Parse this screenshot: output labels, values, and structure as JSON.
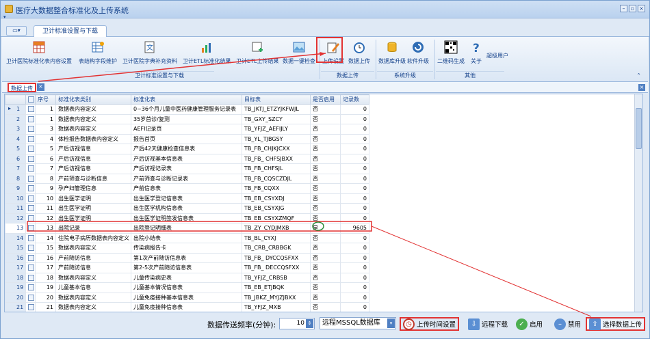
{
  "window": {
    "title": "医疗大数据整合标准化及上传系统"
  },
  "tabs": [
    {
      "label": "卫计标准设置与下载"
    }
  ],
  "ribbon": {
    "buttons": [
      {
        "label": "卫计医院标准化表内容设置",
        "icon": "grid-icon"
      },
      {
        "label": "表结构字段维护",
        "icon": "table-edit-icon"
      },
      {
        "label": "卫计医院字典补充资料",
        "icon": "dictionary-icon"
      },
      {
        "label": "卫计ETL标准化结果",
        "icon": "chart-icon"
      },
      {
        "label": "卫计ETL上传结果",
        "icon": "upload-result-icon"
      },
      {
        "label": "数据一键检查",
        "icon": "picture-check-icon"
      },
      {
        "label": "上传设置",
        "icon": "pencil-icon"
      },
      {
        "label": "数据上传",
        "icon": "clock-icon"
      },
      {
        "label": "数据库升级",
        "icon": "database-icon"
      },
      {
        "label": "软件升级",
        "icon": "refresh-icon"
      },
      {
        "label": "二维码生成",
        "icon": "qrcode-icon"
      },
      {
        "label": "关于",
        "icon": "question-icon"
      },
      {
        "label": "超级用户",
        "icon": ""
      }
    ],
    "groups": [
      "卫计标准设置与下载",
      "数据上传",
      "系统升级",
      "其他"
    ]
  },
  "panel": {
    "title": "数据上传"
  },
  "table": {
    "columns": [
      "序号",
      "标准化表类别",
      "标准化表",
      "目标表",
      "是否启用",
      "记录数"
    ],
    "rows": [
      {
        "rownum": "1",
        "no": "1",
        "category": "数据表内容定义",
        "table": "0~36个月儿童中医药健康管理服务记录表",
        "target": "TB_JKTJ_ETZYJKFWJL",
        "enabled": "否",
        "count": "0"
      },
      {
        "rownum": "2",
        "no": "1",
        "category": "数据表内容定义",
        "table": "35岁首诊/复测",
        "target": "TB_GXY_SZCY",
        "enabled": "否",
        "count": "0"
      },
      {
        "rownum": "3",
        "no": "3",
        "category": "数据表内容定义",
        "table": "AEFI记录页",
        "target": "TB_YFJZ_AEFIJLY",
        "enabled": "否",
        "count": "0"
      },
      {
        "rownum": "4",
        "no": "4",
        "category": "体检报告数据表内容定义",
        "table": "报告首页",
        "target": "TB_YL_TJBGSY",
        "enabled": "否",
        "count": "0"
      },
      {
        "rownum": "5",
        "no": "5",
        "category": "产后访视信息",
        "table": "产后42天健康检查信息表",
        "target": "TB_FB_CHJKJCXX",
        "enabled": "否",
        "count": "0"
      },
      {
        "rownum": "6",
        "no": "6",
        "category": "产后访视信息",
        "table": "产后访视基本信息表",
        "target": "TB_FB_ CHFSJBXX",
        "enabled": "否",
        "count": "0"
      },
      {
        "rownum": "7",
        "no": "7",
        "category": "产后访视信息",
        "table": "产后访视记录表",
        "target": "TB_FB_CHFSJL",
        "enabled": "否",
        "count": "0"
      },
      {
        "rownum": "8",
        "no": "8",
        "category": "产前筛查与诊断信息",
        "table": "产前筛查与诊断记录表",
        "target": "TB_FB_CQSCZDJL",
        "enabled": "否",
        "count": "0"
      },
      {
        "rownum": "9",
        "no": "9",
        "category": "孕产妇管理信息",
        "table": "产前信息表",
        "target": "TB_FB_CQXX",
        "enabled": "否",
        "count": "0"
      },
      {
        "rownum": "10",
        "no": "10",
        "category": "出生医学证明",
        "table": "出生医学登记信息表",
        "target": "TB_EB_CSYXDJ",
        "enabled": "否",
        "count": "0"
      },
      {
        "rownum": "11",
        "no": "11",
        "category": "出生医学证明",
        "table": "出生医学机构信息表",
        "target": "TB_EB_CSYXJG",
        "enabled": "否",
        "count": "0"
      },
      {
        "rownum": "12",
        "no": "12",
        "category": "出生医学证明",
        "table": "出生医学证明签发信息表",
        "target": "TB_EB_CSYXZMQF",
        "enabled": "否",
        "count": "0"
      },
      {
        "rownum": "13",
        "no": "13",
        "category": "出院记录",
        "table": "出院登记明细表",
        "target": "TB_ZY_CYDJMXB",
        "enabled": "是",
        "count": "9605"
      },
      {
        "rownum": "14",
        "no": "14",
        "category": "住院电子病历数据表内容定义",
        "table": "出院小结表",
        "target": "TB_BL_CYXJ",
        "enabled": "否",
        "count": "0"
      },
      {
        "rownum": "15",
        "no": "15",
        "category": "数据表内容定义",
        "table": "传染病报告卡",
        "target": "TB_CRB_CRBBGK",
        "enabled": "否",
        "count": "0"
      },
      {
        "rownum": "16",
        "no": "16",
        "category": "产前随访信息",
        "table": "第1次产前随访信息表",
        "target": "TB_FB_ DYCCQSFXX",
        "enabled": "否",
        "count": "0"
      },
      {
        "rownum": "17",
        "no": "17",
        "category": "产前随访信息",
        "table": "第2-5次产前随访信息表",
        "target": "TB_FB_ DECCQSFXX",
        "enabled": "否",
        "count": "0"
      },
      {
        "rownum": "18",
        "no": "18",
        "category": "数据表内容定义",
        "table": "儿童传染病史表",
        "target": "TB_YFJZ_CRBSB",
        "enabled": "否",
        "count": "0"
      },
      {
        "rownum": "19",
        "no": "19",
        "category": "儿童基本信息",
        "table": "儿童基本情况信息表",
        "target": "TB_EB_ETJBQK",
        "enabled": "否",
        "count": "0"
      },
      {
        "rownum": "20",
        "no": "20",
        "category": "数据表内容定义",
        "table": "儿童免疫接种基本信息表",
        "target": "TB_JBKZ_MYJZJBXX",
        "enabled": "否",
        "count": "0"
      },
      {
        "rownum": "21",
        "no": "21",
        "category": "数据表内容定义",
        "table": "儿童免疫接种信息表",
        "target": "TB_YFJZ_MXB",
        "enabled": "否",
        "count": "0"
      }
    ]
  },
  "bottom": {
    "freq_label": "数据传送频率(分钟):",
    "freq_value": "10",
    "db_select": "远程MSSQL数据库",
    "upload_time_btn": "上传时间设置",
    "remote_download_btn": "远程下载",
    "enable_btn": "启用",
    "disable_btn": "禁用",
    "select_upload_btn": "选择数据上传"
  },
  "colors": {
    "accent": "#15428b",
    "annotation": "#e23232",
    "highlight_circle": "#2e8b3a"
  }
}
